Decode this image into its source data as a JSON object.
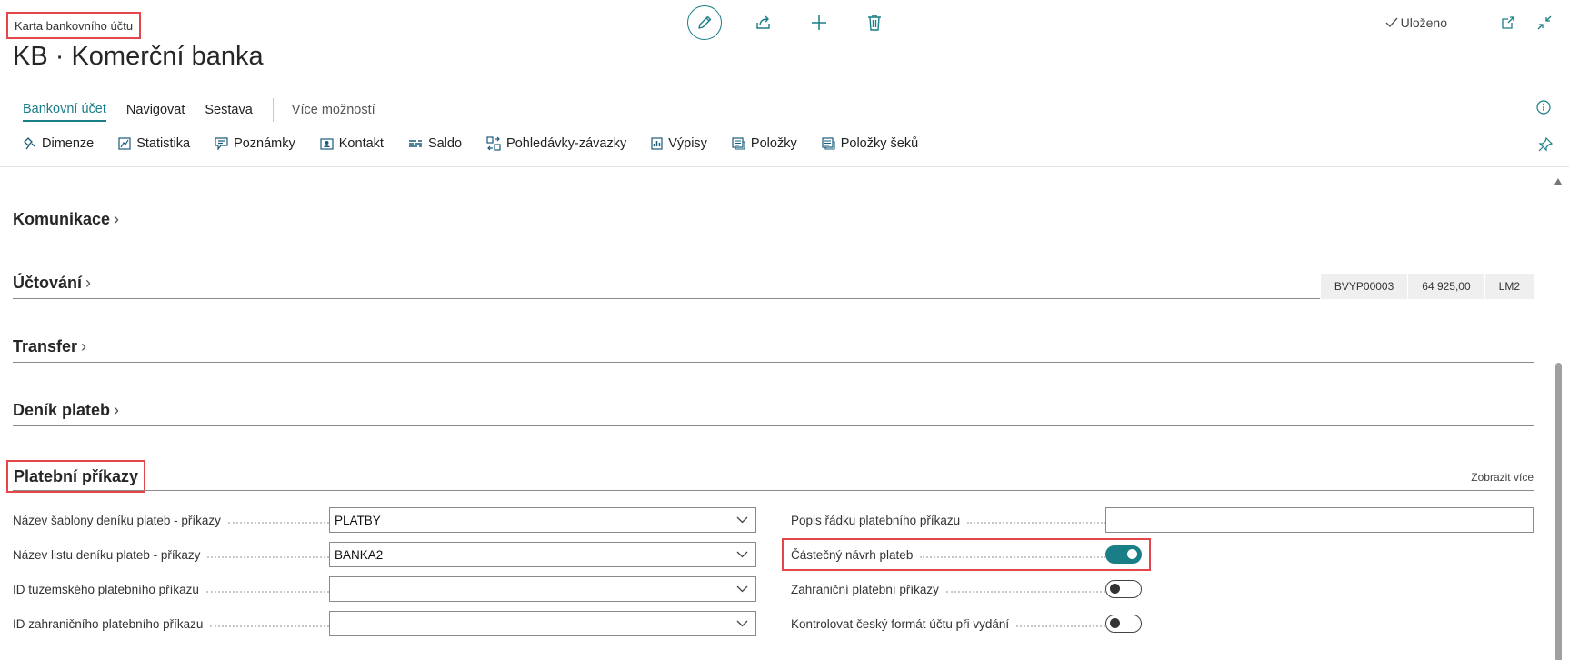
{
  "header": {
    "page_type": "Karta bankovního účtu",
    "title": "KB · Komerční banka",
    "saved_label": "Uloženo"
  },
  "icons": {
    "edit": "pencil-icon",
    "share": "share-icon",
    "new": "plus-icon",
    "delete": "trash-icon",
    "saved": "check-icon",
    "open_new_window": "open-new-window-icon",
    "collapse": "collapse-icon",
    "info": "info-icon",
    "pin": "pin-icon"
  },
  "action_bar": {
    "tabs": [
      "Bankovní účet",
      "Navigovat",
      "Sestava"
    ],
    "more": "Více možností"
  },
  "promoted_actions": [
    {
      "label": "Dimenze",
      "icon": "dimensions-icon"
    },
    {
      "label": "Statistika",
      "icon": "statistics-icon"
    },
    {
      "label": "Poznámky",
      "icon": "notes-icon"
    },
    {
      "label": "Kontakt",
      "icon": "contact-icon"
    },
    {
      "label": "Saldo",
      "icon": "balance-icon"
    },
    {
      "label": "Pohledávky-závazky",
      "icon": "receivables-payables-icon"
    },
    {
      "label": "Výpisy",
      "icon": "statements-icon"
    },
    {
      "label": "Položky",
      "icon": "entries-icon"
    },
    {
      "label": "Položky šeků",
      "icon": "check-entries-icon"
    }
  ],
  "fasttabs": [
    {
      "title": "Komunikace",
      "facts": []
    },
    {
      "title": "Účtování",
      "facts": [
        "BVYP00003",
        "64 925,00",
        "LM2"
      ]
    },
    {
      "title": "Transfer",
      "facts": []
    },
    {
      "title": "Deník plateb",
      "facts": []
    }
  ],
  "payment_orders": {
    "title": "Platební příkazy",
    "show_more": "Zobrazit více",
    "left_fields": [
      {
        "label": "Název šablony deníku plateb - příkazy",
        "value": "PLATBY"
      },
      {
        "label": "Název listu deníku plateb - příkazy",
        "value": "BANKA2"
      },
      {
        "label": "ID tuzemského platebního příkazu",
        "value": ""
      },
      {
        "label": "ID zahraničního platebního příkazu",
        "value": ""
      }
    ],
    "right_fields": [
      {
        "label": "Popis řádku platebního příkazu",
        "value": ""
      },
      {
        "label": "Částečný návrh plateb",
        "on": true
      },
      {
        "label": "Zahraniční platební příkazy",
        "on": false
      },
      {
        "label": "Kontrolovat český formát účtu při vydání",
        "on": false
      }
    ]
  },
  "colors": {
    "accent": "#1a7e87",
    "highlight": "#e3474a"
  }
}
